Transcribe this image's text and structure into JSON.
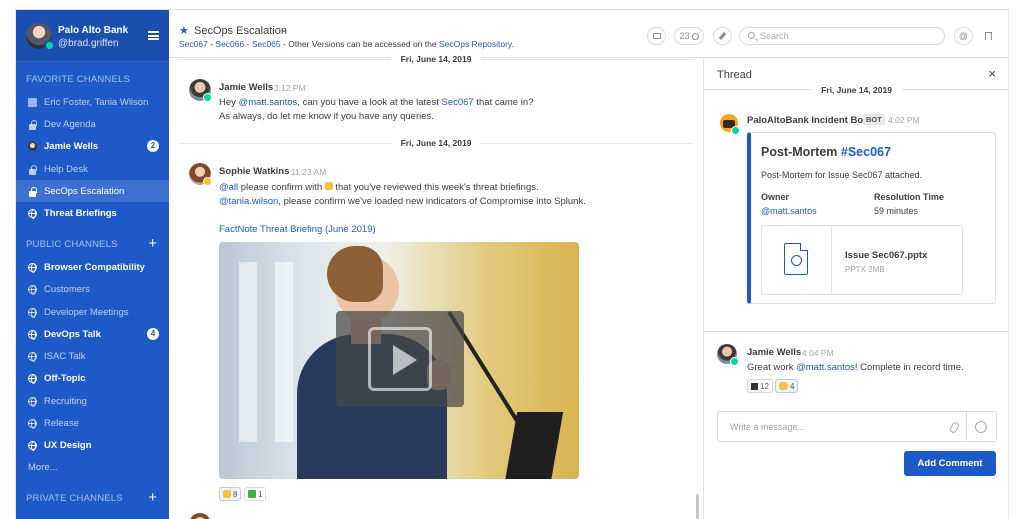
{
  "sidebar": {
    "team_name": "Palo Alto Bank",
    "username": "@brad.griffen",
    "favorite_header": "FAVORITE CHANNELS",
    "public_header": "PUBLIC CHANNELS",
    "private_header": "PRIVATE CHANNELS",
    "favorites": [
      {
        "label": "Eric Foster, Tania Wilson",
        "icon": "dm-icon",
        "badge": ""
      },
      {
        "label": "Dev Agenda",
        "icon": "lock-icon",
        "badge": ""
      },
      {
        "label": "Jamie Wells",
        "icon": "user-icon",
        "badge": "2"
      },
      {
        "label": "Help Desk",
        "icon": "lock-icon",
        "badge": ""
      },
      {
        "label": "SecOps Escalation",
        "icon": "lock-icon",
        "badge": ""
      },
      {
        "label": "Threat Briefings",
        "icon": "globe-icon",
        "badge": ""
      }
    ],
    "public": [
      {
        "label": "Browser Compatibility",
        "badge": ""
      },
      {
        "label": "Customers",
        "badge": ""
      },
      {
        "label": "Developer Meetings",
        "badge": ""
      },
      {
        "label": "DevOps Talk",
        "badge": "4"
      },
      {
        "label": "ISAC Talk",
        "badge": ""
      },
      {
        "label": "Off-Topic",
        "badge": ""
      },
      {
        "label": "Recruiting",
        "badge": ""
      },
      {
        "label": "Release",
        "badge": ""
      },
      {
        "label": "UX Design",
        "badge": ""
      }
    ],
    "more_label": "More...",
    "plus": "+"
  },
  "header": {
    "star": "★",
    "title": "SecOps Escalation",
    "chevron": "⌄",
    "versions": [
      "Sec067",
      "Sec066",
      "Sec065"
    ],
    "sep": " - ",
    "versions_text": " - Other Versions can be accessed on the ",
    "repo_link": "SecOps Repository",
    "repo_end": ".",
    "member_count": "23",
    "search_placeholder": "Search"
  },
  "messages": {
    "date1": "Fri, June 14, 2019",
    "date2": "Fri, June 14, 2019",
    "m1": {
      "name": "Jamie Wells",
      "time": "3:12 PM",
      "l1_pre": "Hey ",
      "l1_mention": "@matt.santos",
      "l1_mid": ", can you have a look at the latest ",
      "l1_link": "Sec067",
      "l1_post": " that came in?",
      "l2": "As always, do let me know if you have any queries."
    },
    "m2": {
      "name": "Sophie Watkins",
      "time": "11:23 AM",
      "l1_mention": "@all",
      "l1_pre": " please confirm with ",
      "l1_post": " that you've reviewed this week's threat briefings.",
      "l2_mention": "@tania.wilson",
      "l2_post": ", please confirm we've loaded new indicators of Compromise into Splunk.",
      "link": "FactNote Threat Briefing (June 2019)",
      "react1": "8",
      "react2": "1"
    }
  },
  "thread": {
    "title": "Thread",
    "close": "×",
    "date": "Fri, June 14, 2019",
    "bot_name": "PaloAltoBank Incident Bot",
    "bot_tag": "BOT",
    "bot_time": "4:02 PM",
    "att_title_pre": "Post-Mortem ",
    "att_title_link": "#Sec067",
    "att_text": "Post-Mortem for Issue Sec067 attached.",
    "owner_label": "Owner",
    "owner_value": "@matt.santos",
    "res_label": "Resolution Time",
    "res_value": "59 minutes",
    "file_name": "Issue Sec067.pptx",
    "file_meta": "PPTX 2MB",
    "reply_name": "Jamie Wells",
    "reply_time": "4:04 PM",
    "reply_pre": "Great work ",
    "reply_mention": "@matt.santos",
    "reply_post": "! Complete in record time.",
    "react1": "12",
    "react2": "4",
    "input_placeholder": "Write a message...",
    "button": "Add Comment"
  },
  "colors": {
    "sidebar": "#1e5ac7",
    "accent": "#1e5ac7",
    "online": "#06d6a0"
  }
}
